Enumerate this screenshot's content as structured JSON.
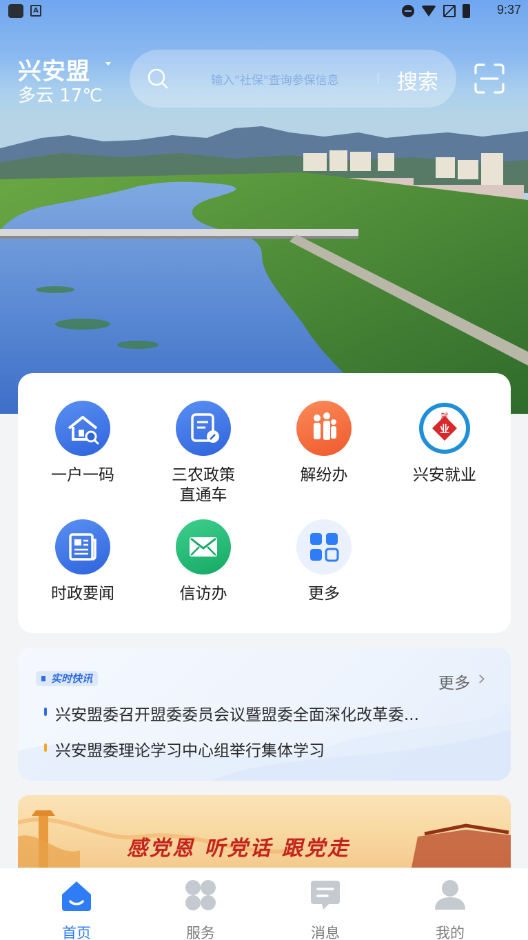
{
  "status_bar": {
    "time": "9:37"
  },
  "header": {
    "city": "兴安盟",
    "weather": "多云 17℃",
    "search_placeholder": "输入\"社保\"查询参保信息",
    "search_button": "搜索"
  },
  "services": [
    {
      "label": "一户一码",
      "icon": "house-search-icon"
    },
    {
      "label": "三农政策\n直通车",
      "icon": "policy-doc-icon"
    },
    {
      "label": "解纷办",
      "icon": "family-icon"
    },
    {
      "label": "兴安就业",
      "icon": "xingan-employment-logo-icon"
    },
    {
      "label": "时政要闻",
      "icon": "newspaper-icon"
    },
    {
      "label": "信访办",
      "icon": "envelope-icon"
    },
    {
      "label": "更多",
      "icon": "grid-more-icon"
    }
  ],
  "news": {
    "tag": "实时快讯",
    "more": "更多",
    "items": [
      {
        "text": "兴安盟委召开盟委委员会议暨盟委全面深化改革委...",
        "color": "#2f6de0"
      },
      {
        "text": "兴安盟委理论学习中心组举行集体学习",
        "color": "#f0a825"
      }
    ]
  },
  "banner": {
    "text": "感党恩 听党话 跟党走"
  },
  "tabbar": [
    {
      "label": "首页",
      "icon": "home-icon",
      "active": true
    },
    {
      "label": "服务",
      "icon": "services-icon",
      "active": false
    },
    {
      "label": "消息",
      "icon": "message-icon",
      "active": false
    },
    {
      "label": "我的",
      "icon": "profile-icon",
      "active": false
    }
  ],
  "colors": {
    "accent": "#2f7df6",
    "background": "#f3f4f6"
  }
}
